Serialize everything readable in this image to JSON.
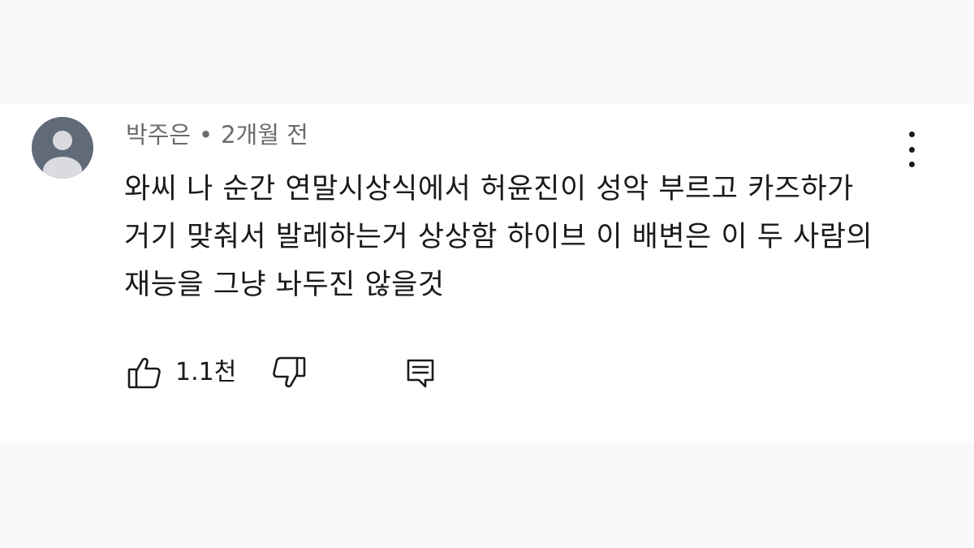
{
  "comment": {
    "author": "박주은",
    "separator": "•",
    "time": "2개월 전",
    "text": "와씨 나 순간 연말시상식에서 허윤진이 성악 부르고 카즈하가 거기 맞춰서 발레하는거 상상함 하이브 이 배변은 이 두 사람의 재능을 그냥 놔두진 않을것",
    "like_count": "1.1천",
    "icons": {
      "avatar": "default-avatar-icon",
      "more": "more-vertical-icon",
      "like": "thumbs-up-icon",
      "dislike": "thumbs-down-icon",
      "reply": "reply-comment-icon"
    }
  },
  "colors": {
    "page_background": "#f9f9f9",
    "card_background": "#ffffff",
    "avatar_background": "#606a78",
    "avatar_figure": "#d9dbdf",
    "text_primary": "#1a1a1a",
    "text_secondary": "#6b6b6b"
  }
}
